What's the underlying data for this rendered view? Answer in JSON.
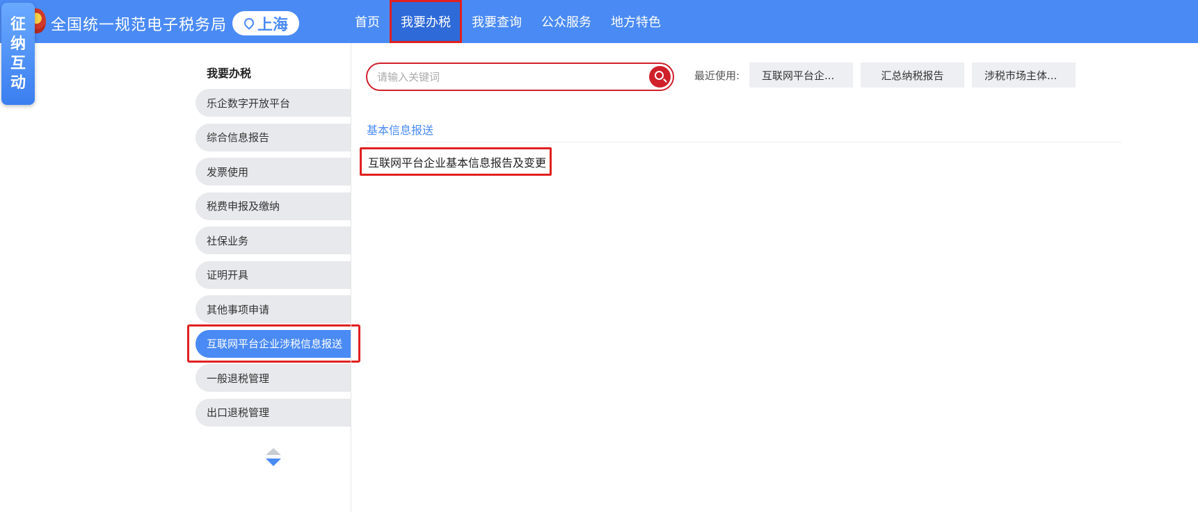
{
  "header": {
    "site_title": "全国统一规范电子税务局",
    "region": "上海",
    "nav": [
      "首页",
      "我要办税",
      "我要查询",
      "公众服务",
      "地方特色"
    ],
    "active_nav": "我要办税"
  },
  "float_tab": {
    "chars": [
      "征",
      "纳",
      "互",
      "动"
    ]
  },
  "sidebar": {
    "title": "我要办税",
    "items": [
      "乐企数字开放平台",
      "综合信息报告",
      "发票使用",
      "税费申报及缴纳",
      "社保业务",
      "证明开具",
      "其他事项申请",
      "互联网平台企业涉税信息报送",
      "一般退税管理",
      "出口退税管理"
    ],
    "active_index": 7
  },
  "search": {
    "placeholder": "请输入关键词",
    "value": ""
  },
  "recent": {
    "label": "最近使用:",
    "chips": [
      "互联网平台企...",
      "汇总纳税报告",
      "涉税市场主体..."
    ]
  },
  "content": {
    "category": "基本信息报送",
    "result": "互联网平台企业基本信息报告及变更"
  },
  "colors": {
    "header_bg": "#4a8af4",
    "nav_active_bg": "#2f6ad9",
    "highlight_red": "#e02020",
    "search_red": "#d0202a",
    "menu_bg": "#e8e9ec"
  }
}
